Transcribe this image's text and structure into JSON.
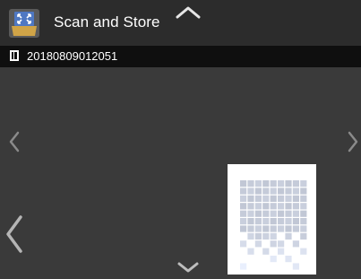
{
  "header": {
    "title": "Scan and Store",
    "app_icon": "scan-and-store-icon",
    "scroll_up_icon": "chevron-up-icon"
  },
  "file": {
    "name": "20180809012051",
    "icon": "document-icon"
  },
  "navigation": {
    "prev_small_icon": "chevron-left-icon",
    "next_small_icon": "chevron-right-icon",
    "prev_large_icon": "chevron-left-large-icon",
    "scroll_down_icon": "chevron-down-icon"
  },
  "preview": {
    "thumbnail": "page-thumbnail"
  },
  "colors": {
    "background": "#3a3a3a",
    "topbar": "#2c2c2c",
    "filebar": "#0f0f0f",
    "text": "#ffffff",
    "icon_gold": "#d0a447",
    "icon_blue": "#4f78c2"
  }
}
